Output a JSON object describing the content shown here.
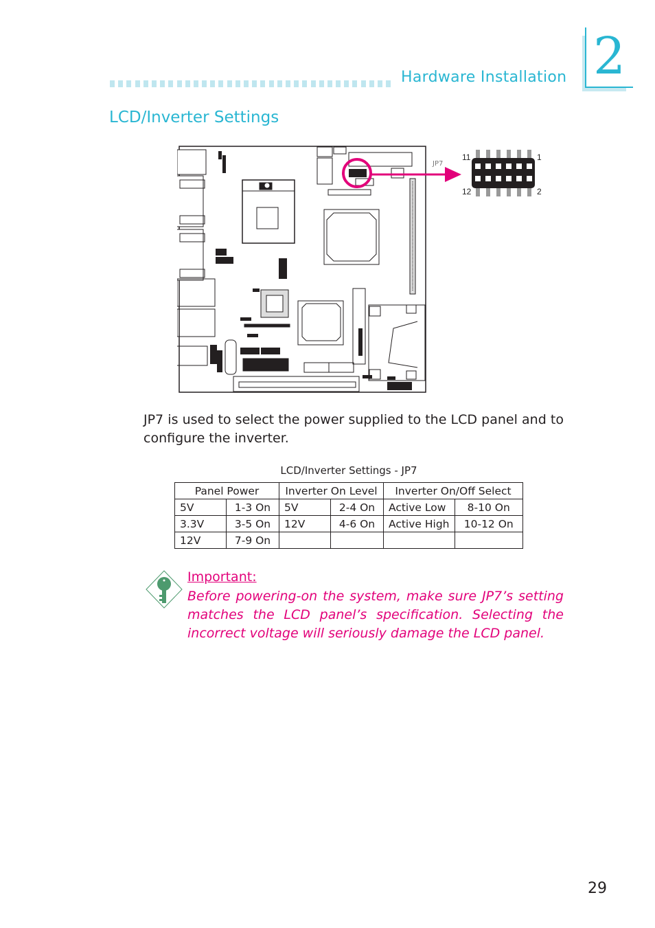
{
  "header": {
    "section_title": "Hardware Installation",
    "chapter_number": "2"
  },
  "page_heading": "LCD/Inverter Settings",
  "diagram": {
    "jumper_label": "JP7",
    "pin_labels": {
      "top_left": "11",
      "top_right": "1",
      "bottom_left": "12",
      "bottom_right": "2"
    },
    "highlight_color": "#e2007a"
  },
  "intro_text": "JP7 is used to select the power supplied to the LCD panel and to configure the inverter.",
  "table": {
    "caption": "LCD/Inverter  Settings  -  JP7",
    "headers": [
      "Panel  Power",
      "Inverter  On  Level",
      "Inverter  On/Off  Select"
    ],
    "rows": [
      [
        "5V",
        "1-3  On",
        "5V",
        "2-4  On",
        "Active  Low",
        "8-10  On"
      ],
      [
        "3.3V",
        "3-5  On",
        "12V",
        "4-6  On",
        "Active  High",
        "10-12  On"
      ],
      [
        "12V",
        "7-9  On",
        "",
        "",
        "",
        ""
      ]
    ]
  },
  "important": {
    "title": "Important:",
    "text": "Before powering-on the system, make sure JP7’s setting matches the LCD panel’s specification. Selecting the incorrect voltage will seriously damage the LCD panel.",
    "icon": "key-icon"
  },
  "page_number": "29",
  "colors": {
    "accent": "#29b6d2",
    "warning": "#e2007a",
    "icon_green": "#4d9a6e"
  }
}
